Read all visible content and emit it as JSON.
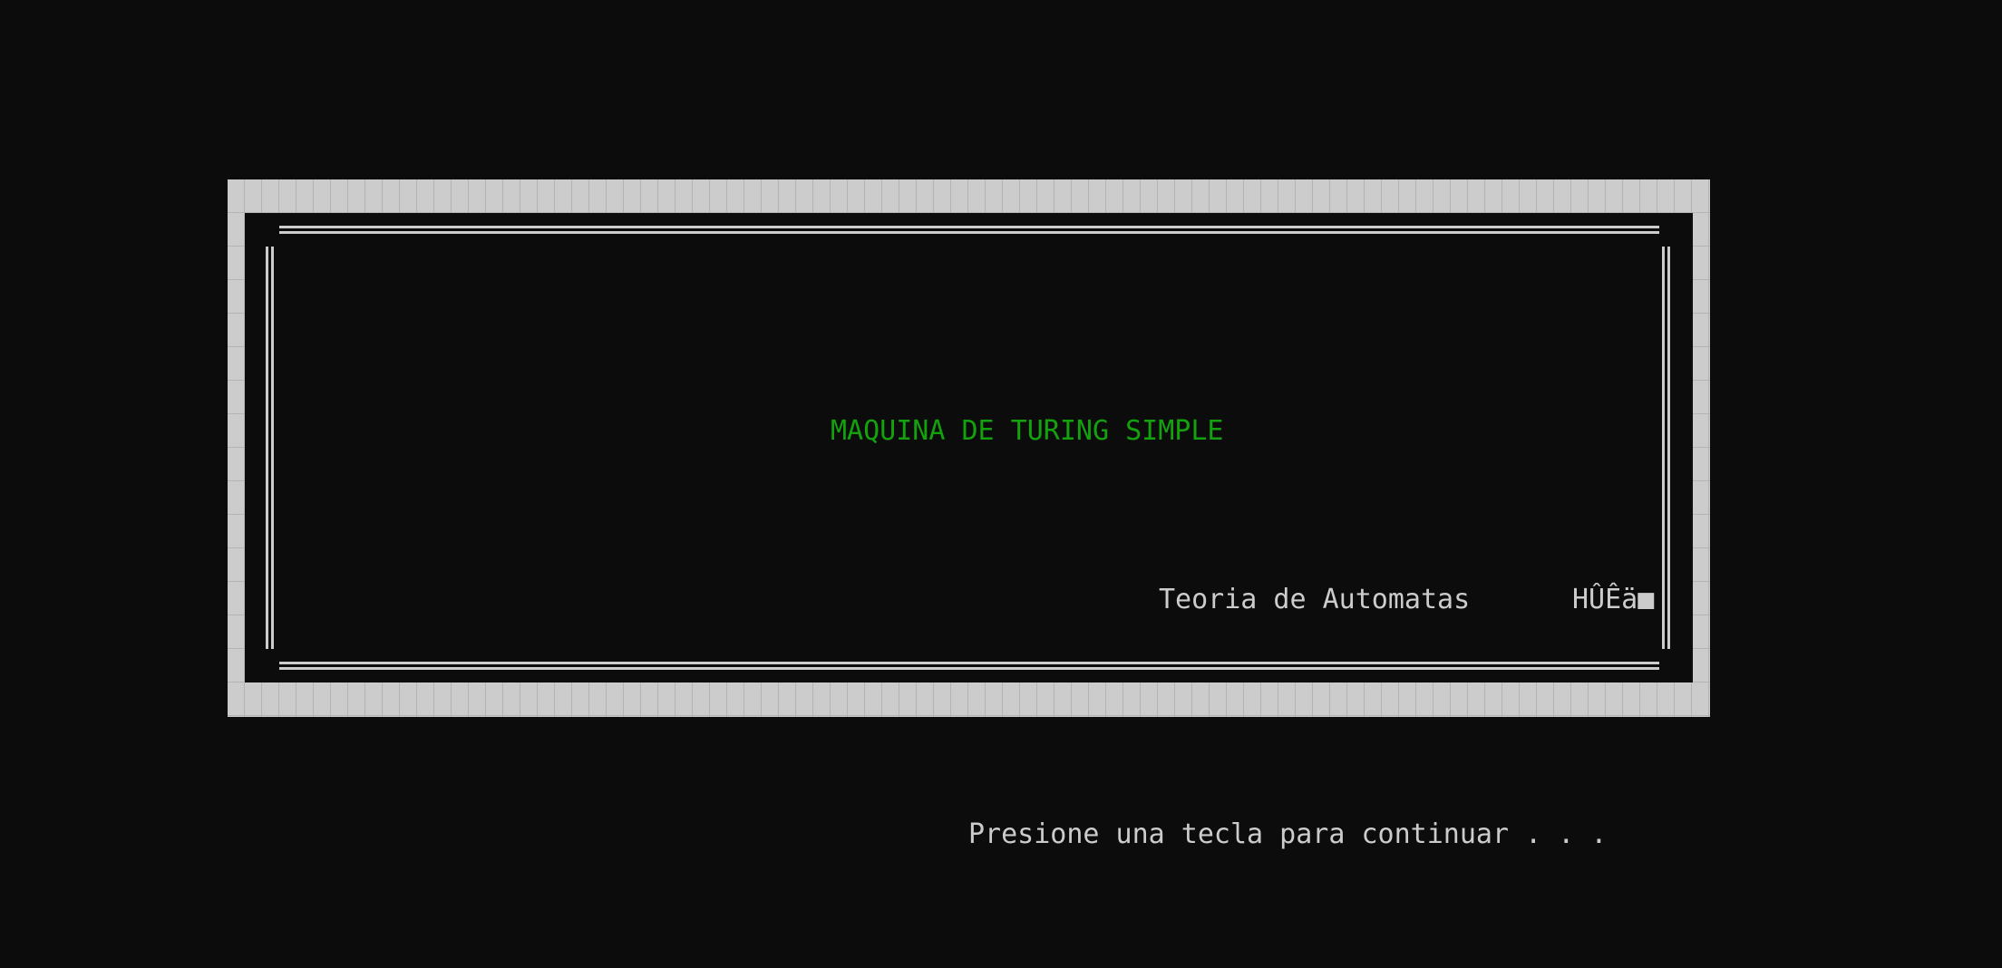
{
  "console": {
    "title": "MAQUINA DE TURING SIMPLE",
    "subtitle": "Teoria de Automatas",
    "garbled_text": "HÛÊä■",
    "prompt": "Presione una tecla para continuar . . ."
  },
  "colors": {
    "background": "#0c0c0c",
    "text": "#cccccc",
    "title": "#13a10e",
    "frame": "#cccccc"
  }
}
